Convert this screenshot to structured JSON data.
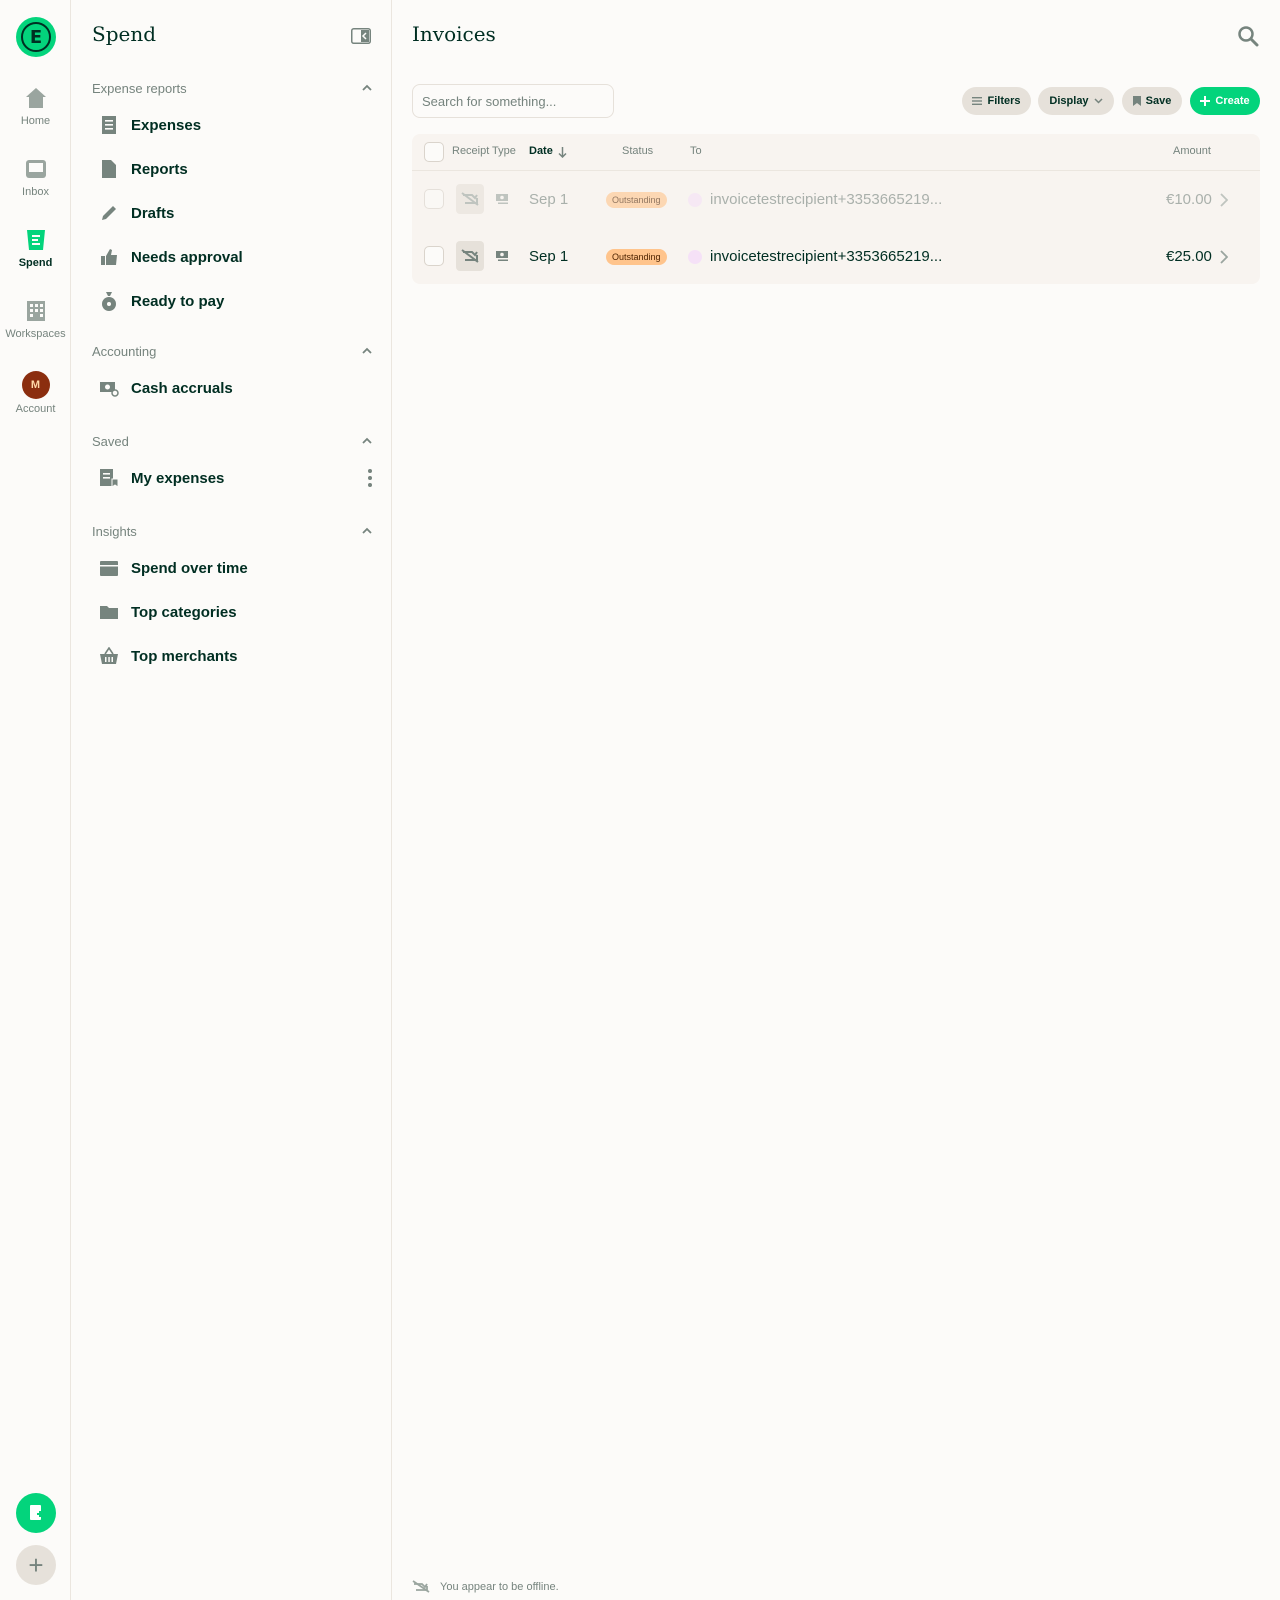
{
  "nav": {
    "logo_letter": "E",
    "items": [
      {
        "label": "Home",
        "icon": "home-icon"
      },
      {
        "label": "Inbox",
        "icon": "inbox-icon"
      },
      {
        "label": "Spend",
        "icon": "spend-icon"
      },
      {
        "label": "Workspaces",
        "icon": "building-icon"
      },
      {
        "label": "Account",
        "icon": "avatar"
      }
    ],
    "avatar_initial": "M",
    "plus_label": "+"
  },
  "sidebar": {
    "title": "Spend",
    "sections": [
      {
        "title": "Expense reports",
        "items": [
          "Expenses",
          "Reports",
          "Drafts",
          "Needs approval",
          "Ready to pay"
        ]
      },
      {
        "title": "Accounting",
        "items": [
          "Cash accruals"
        ]
      },
      {
        "title": "Saved",
        "items": [
          "My expenses"
        ]
      },
      {
        "title": "Insights",
        "items": [
          "Spend over time",
          "Top categories",
          "Top merchants"
        ]
      }
    ]
  },
  "main": {
    "title": "Invoices",
    "search_placeholder": "Search for something...",
    "toolbar": {
      "filters": "Filters",
      "display": "Display",
      "save": "Save",
      "create": "Create"
    },
    "columns": {
      "receipt": "Receipt",
      "type": "Type",
      "date": "Date",
      "status": "Status",
      "to": "To",
      "amount": "Amount"
    },
    "rows": [
      {
        "date": "Sep 1",
        "status": "Outstanding",
        "to": "invoicetestrecipient+3353665219...",
        "amount": "€10.00"
      },
      {
        "date": "Sep 1",
        "status": "Outstanding",
        "to": "invoicetestrecipient+3353665219...",
        "amount": "€25.00"
      }
    ],
    "offline_message": "You appear to be offline."
  },
  "colors": {
    "accent": "#03d47c",
    "text": "#002e22",
    "muted": "#76847e",
    "badge": "#ffc48c"
  }
}
